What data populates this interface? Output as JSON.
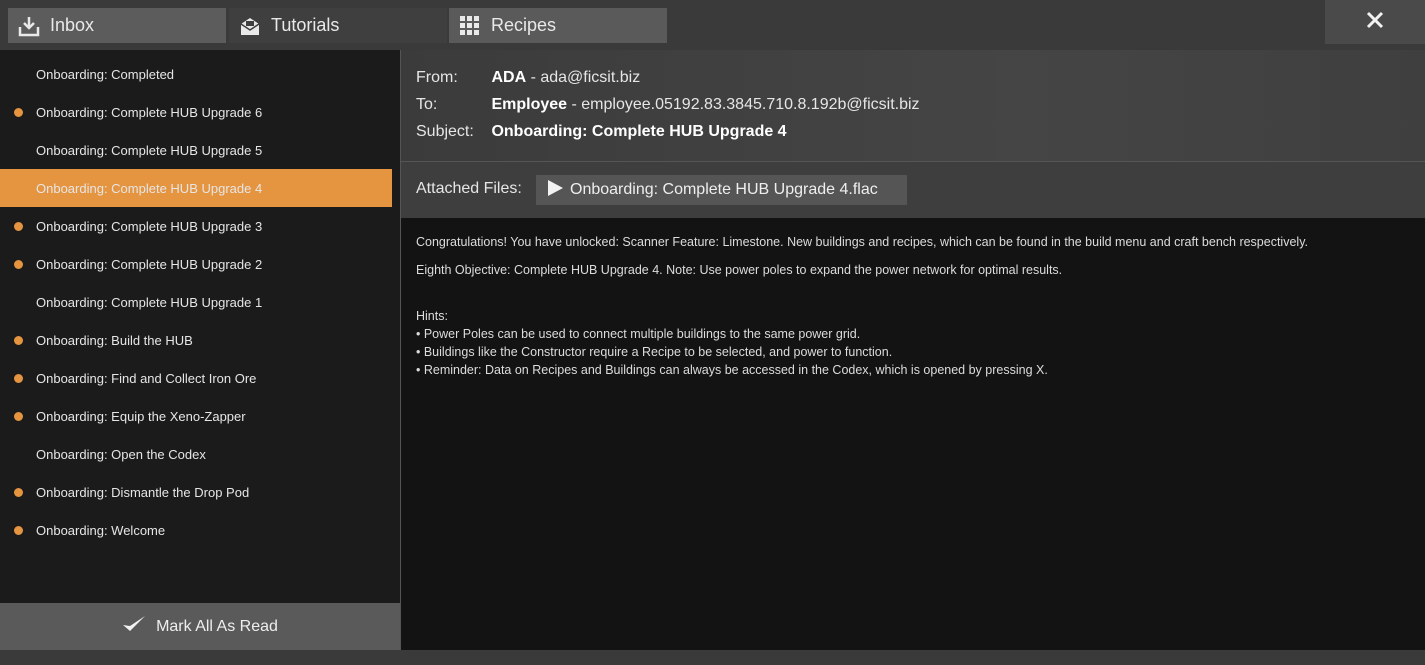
{
  "tabs": [
    {
      "label": "Inbox",
      "icon": "inbox-download-icon"
    },
    {
      "label": "Tutorials",
      "icon": "open-envelope-icon"
    },
    {
      "label": "Recipes",
      "icon": "grid-icon"
    }
  ],
  "close": {
    "icon": "close-icon"
  },
  "accent": "#e59440",
  "mail_list": [
    {
      "title": "Onboarding: Completed",
      "unread": false,
      "active": false
    },
    {
      "title": "Onboarding: Complete HUB Upgrade 6",
      "unread": true,
      "active": false
    },
    {
      "title": "Onboarding: Complete HUB Upgrade 5",
      "unread": false,
      "active": false
    },
    {
      "title": "Onboarding: Complete HUB Upgrade 4",
      "unread": false,
      "active": true
    },
    {
      "title": "Onboarding: Complete HUB Upgrade 3",
      "unread": true,
      "active": false
    },
    {
      "title": "Onboarding: Complete HUB Upgrade 2",
      "unread": true,
      "active": false
    },
    {
      "title": "Onboarding: Complete HUB Upgrade 1",
      "unread": false,
      "active": false
    },
    {
      "title": "Onboarding: Build the HUB",
      "unread": true,
      "active": false
    },
    {
      "title": "Onboarding: Find and Collect Iron Ore",
      "unread": true,
      "active": false
    },
    {
      "title": "Onboarding: Equip the Xeno-Zapper",
      "unread": true,
      "active": false
    },
    {
      "title": "Onboarding: Open the Codex",
      "unread": false,
      "active": false
    },
    {
      "title": "Onboarding: Dismantle the Drop Pod",
      "unread": true,
      "active": false
    },
    {
      "title": "Onboarding: Welcome",
      "unread": true,
      "active": false
    }
  ],
  "mark_all": {
    "label": "Mark All As Read",
    "icon": "checkmark-icon"
  },
  "message": {
    "from_label": "From:",
    "from_name": "ADA",
    "from_email": "ada@ficsit.biz",
    "to_label": "To:",
    "to_name": "Employee",
    "to_email": "employee.05192.83.3845.710.8.192b@ficsit.biz",
    "subject_label": "Subject:",
    "subject": "Onboarding: Complete HUB Upgrade 4",
    "attached_label": "Attached Files:",
    "attachment": "Onboarding: Complete HUB Upgrade 4.flac",
    "attachment_icon": "play-icon",
    "body_lines": [
      "Congratulations! You have unlocked: Scanner Feature: Limestone. New buildings and recipes, which can be found in the build menu and craft bench respectively.",
      "Eighth Objective: Complete HUB Upgrade 4. Note: Use power poles to expand the power network for optimal results.",
      "Hints:",
      "• Power Poles can be used to connect multiple buildings to the same power grid.",
      "• Buildings like the Constructor require a Recipe to be selected, and power to function.",
      "• Reminder: Data on Recipes and Buildings can always be accessed in the Codex, which is opened by pressing X."
    ]
  }
}
